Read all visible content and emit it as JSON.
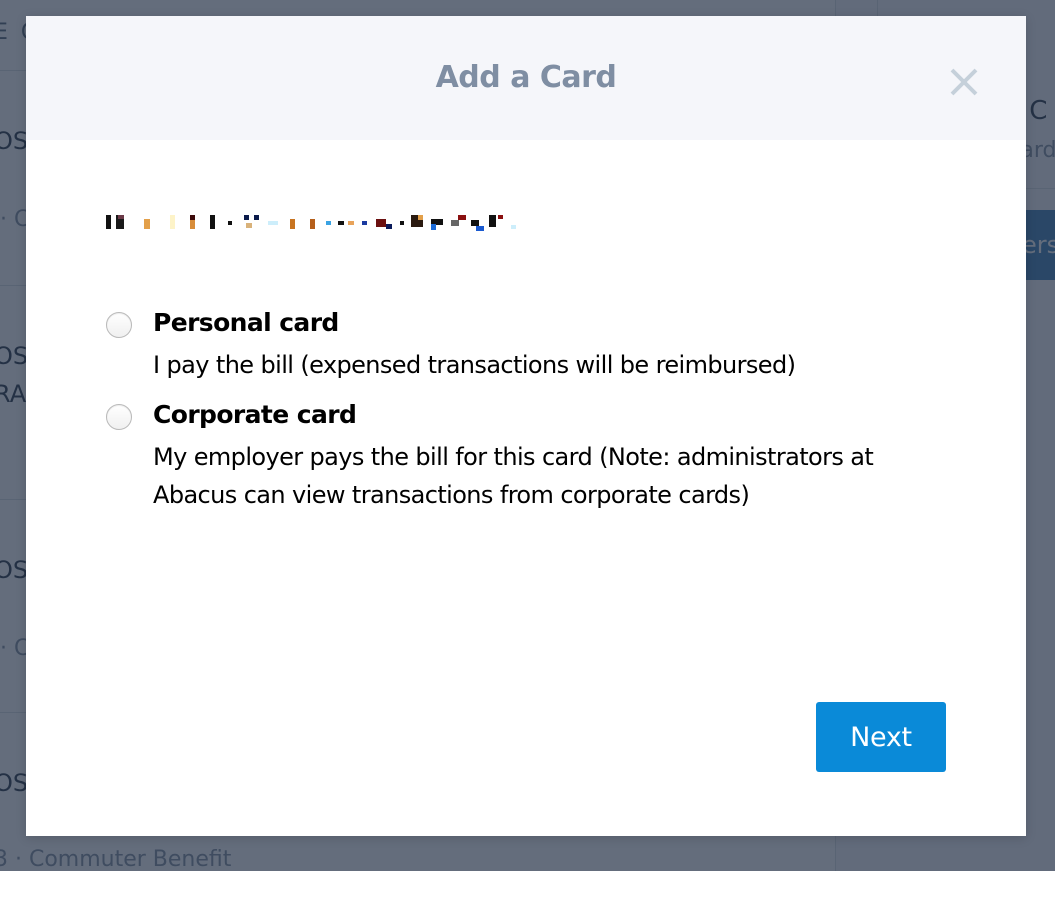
{
  "background": {
    "header_fragment": "E C",
    "rows": [
      {
        "title_fragment": "OS",
        "sub_fragment": "· C"
      },
      {
        "title_fragment": "OS",
        "title_fragment_2": "RAI"
      },
      {
        "title_fragment": "OS",
        "sub_fragment": "· C"
      },
      {
        "title_fragment": "OS",
        "sub_fragment": "3 · Commuter Benefit"
      }
    ],
    "side_title_fragment": "e C",
    "side_sub_fragment": "Card",
    "side_button_fragment": "ers"
  },
  "modal": {
    "title": "Add a Card",
    "close_icon": "close-x-icon",
    "redacted_text_note": "pixelated/redacted text",
    "options": [
      {
        "label": "Personal card",
        "description": "I pay the bill (expensed transactions will be reimbursed)",
        "selected": false
      },
      {
        "label": "Corporate card",
        "description": "My employer pays the bill for this card (Note: administrators at Abacus can view transactions from corporate cards)",
        "selected": false
      }
    ],
    "next_label": "Next"
  },
  "colors": {
    "overlay": "#5d6777",
    "header_bg": "#f5f6fa",
    "title": "#7f8ea3",
    "close_icon": "#c5d0da",
    "primary_button": "#0a8ad8",
    "side_button": "#1f4a6e"
  }
}
